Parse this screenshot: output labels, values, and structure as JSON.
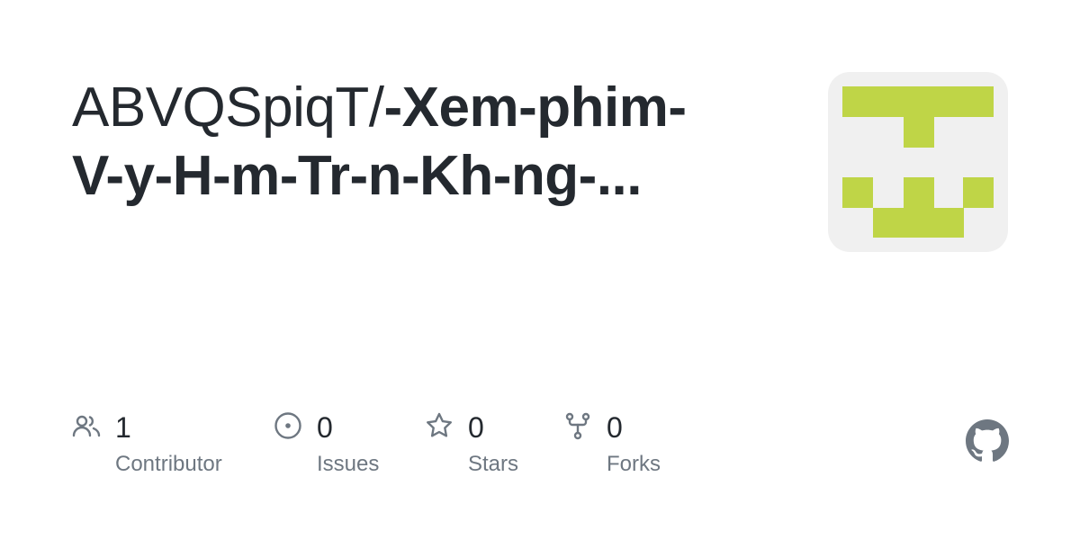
{
  "repo": {
    "owner": "ABVQSpiqT/",
    "name_line1": "-Xem-phim-",
    "name_line2": "V-y-H-m-Tr-n-Kh-ng-..."
  },
  "stats": {
    "contributors": {
      "count": "1",
      "label": "Contributor",
      "icon": "people-icon"
    },
    "issues": {
      "count": "0",
      "label": "Issues",
      "icon": "issue-opened-icon"
    },
    "stars": {
      "count": "0",
      "label": "Stars",
      "icon": "star-icon"
    },
    "forks": {
      "count": "0",
      "label": "Forks",
      "icon": "repo-forked-icon"
    }
  },
  "colors": {
    "text": "#24292f",
    "muted": "#6e7781",
    "avatar_bg": "#f0f0f0",
    "avatar_fg": "#bfd547"
  }
}
